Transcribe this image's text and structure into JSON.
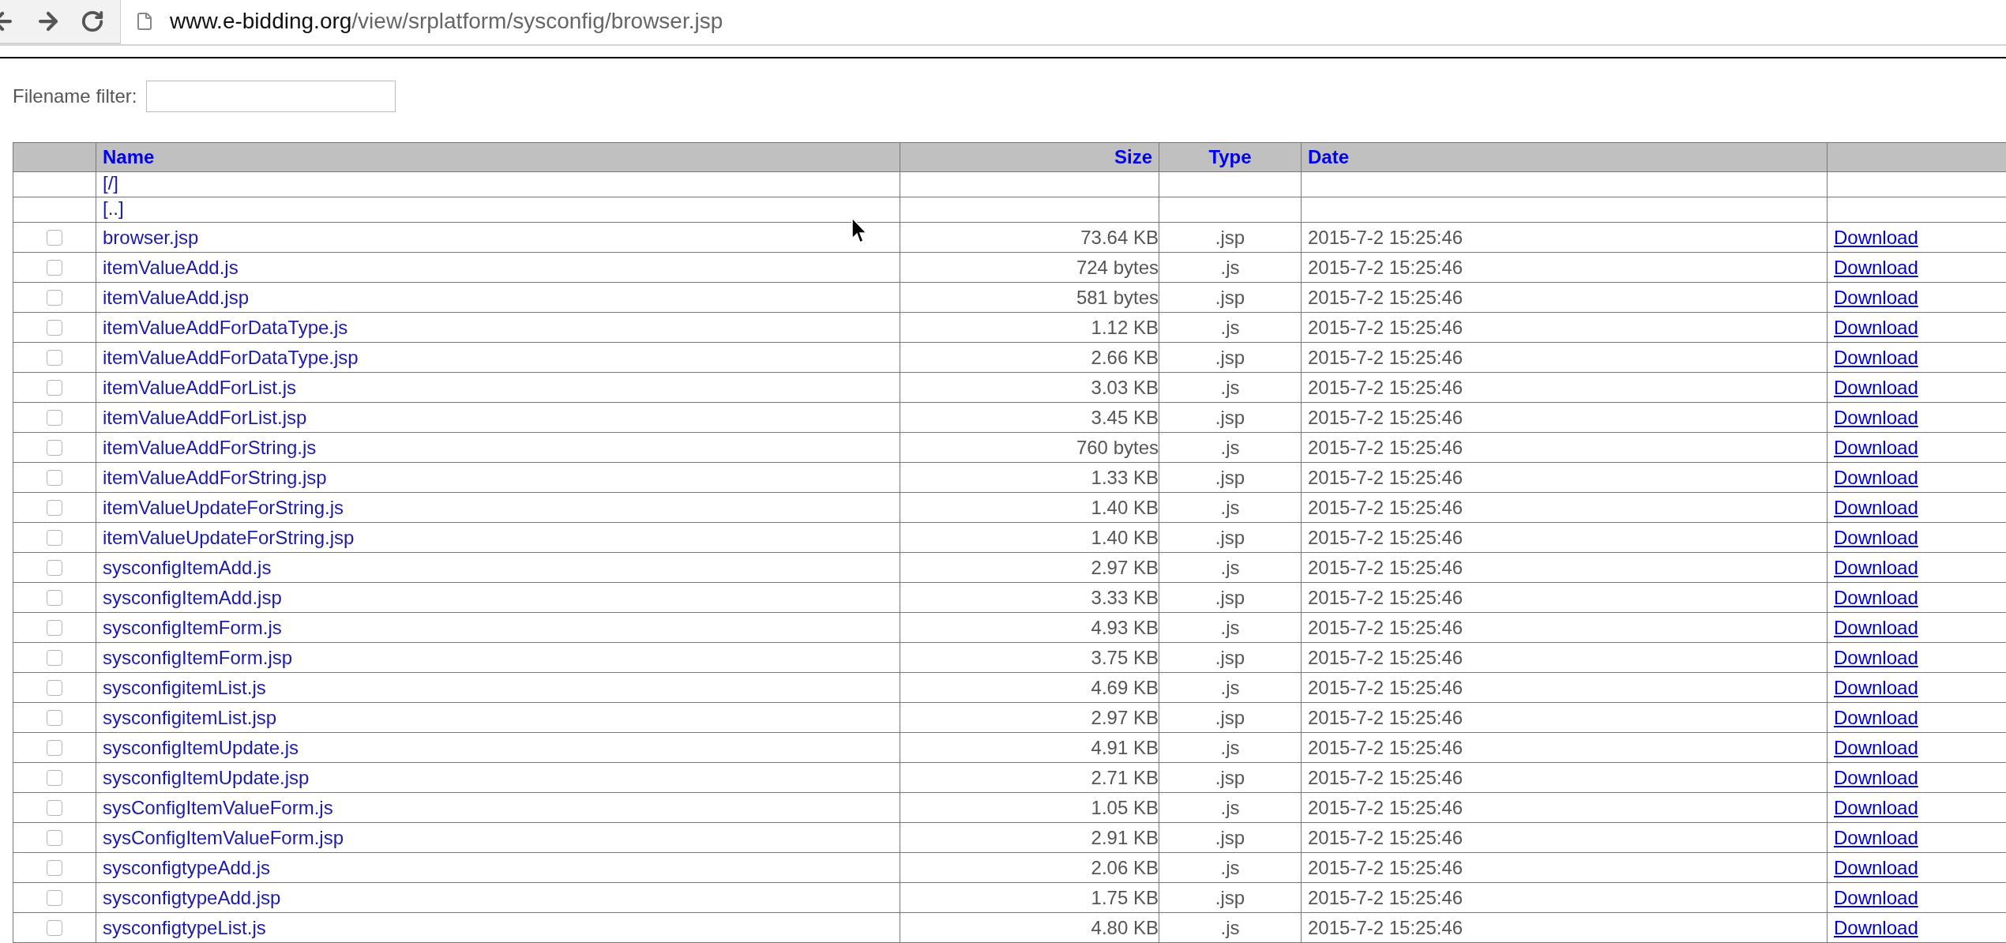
{
  "address_bar": {
    "host": "www.e-bidding.org",
    "path": "/view/srplatform/sysconfig/browser.jsp"
  },
  "filter": {
    "label": "Filename filter:"
  },
  "table": {
    "columns": [
      "Name",
      "Size",
      "Type",
      "Date"
    ],
    "rows": [
      {
        "kind": "dir",
        "name": "[/]"
      },
      {
        "kind": "dir",
        "name": "[..]"
      },
      {
        "kind": "file",
        "checked": false,
        "name": "browser.jsp",
        "size": "73.64 KB",
        "type": ".jsp",
        "date": "2015-7-2 15:25:46",
        "action": "Download"
      },
      {
        "kind": "file",
        "checked": false,
        "name": "itemValueAdd.js",
        "size": "724 bytes",
        "type": ".js",
        "date": "2015-7-2 15:25:46",
        "action": "Download"
      },
      {
        "kind": "file",
        "checked": false,
        "name": "itemValueAdd.jsp",
        "size": "581 bytes",
        "type": ".jsp",
        "date": "2015-7-2 15:25:46",
        "action": "Download"
      },
      {
        "kind": "file",
        "checked": false,
        "name": "itemValueAddForDataType.js",
        "size": "1.12 KB",
        "type": ".js",
        "date": "2015-7-2 15:25:46",
        "action": "Download"
      },
      {
        "kind": "file",
        "checked": false,
        "name": "itemValueAddForDataType.jsp",
        "size": "2.66 KB",
        "type": ".jsp",
        "date": "2015-7-2 15:25:46",
        "action": "Download"
      },
      {
        "kind": "file",
        "checked": false,
        "name": "itemValueAddForList.js",
        "size": "3.03 KB",
        "type": ".js",
        "date": "2015-7-2 15:25:46",
        "action": "Download"
      },
      {
        "kind": "file",
        "checked": false,
        "name": "itemValueAddForList.jsp",
        "size": "3.45 KB",
        "type": ".jsp",
        "date": "2015-7-2 15:25:46",
        "action": "Download"
      },
      {
        "kind": "file",
        "checked": false,
        "name": "itemValueAddForString.js",
        "size": "760 bytes",
        "type": ".js",
        "date": "2015-7-2 15:25:46",
        "action": "Download"
      },
      {
        "kind": "file",
        "checked": false,
        "name": "itemValueAddForString.jsp",
        "size": "1.33 KB",
        "type": ".jsp",
        "date": "2015-7-2 15:25:46",
        "action": "Download"
      },
      {
        "kind": "file",
        "checked": false,
        "name": "itemValueUpdateForString.js",
        "size": "1.40 KB",
        "type": ".js",
        "date": "2015-7-2 15:25:46",
        "action": "Download"
      },
      {
        "kind": "file",
        "checked": false,
        "name": "itemValueUpdateForString.jsp",
        "size": "1.40 KB",
        "type": ".jsp",
        "date": "2015-7-2 15:25:46",
        "action": "Download"
      },
      {
        "kind": "file",
        "checked": false,
        "name": "sysconfigItemAdd.js",
        "size": "2.97 KB",
        "type": ".js",
        "date": "2015-7-2 15:25:46",
        "action": "Download"
      },
      {
        "kind": "file",
        "checked": false,
        "name": "sysconfigItemAdd.jsp",
        "size": "3.33 KB",
        "type": ".jsp",
        "date": "2015-7-2 15:25:46",
        "action": "Download"
      },
      {
        "kind": "file",
        "checked": false,
        "name": "sysconfigItemForm.js",
        "size": "4.93 KB",
        "type": ".js",
        "date": "2015-7-2 15:25:46",
        "action": "Download"
      },
      {
        "kind": "file",
        "checked": false,
        "name": "sysconfigItemForm.jsp",
        "size": "3.75 KB",
        "type": ".jsp",
        "date": "2015-7-2 15:25:46",
        "action": "Download"
      },
      {
        "kind": "file",
        "checked": false,
        "name": "sysconfigitemList.js",
        "size": "4.69 KB",
        "type": ".js",
        "date": "2015-7-2 15:25:46",
        "action": "Download"
      },
      {
        "kind": "file",
        "checked": false,
        "name": "sysconfigitemList.jsp",
        "size": "2.97 KB",
        "type": ".jsp",
        "date": "2015-7-2 15:25:46",
        "action": "Download"
      },
      {
        "kind": "file",
        "checked": false,
        "name": "sysconfigItemUpdate.js",
        "size": "4.91 KB",
        "type": ".js",
        "date": "2015-7-2 15:25:46",
        "action": "Download"
      },
      {
        "kind": "file",
        "checked": false,
        "name": "sysconfigItemUpdate.jsp",
        "size": "2.71 KB",
        "type": ".jsp",
        "date": "2015-7-2 15:25:46",
        "action": "Download"
      },
      {
        "kind": "file",
        "checked": false,
        "name": "sysConfigItemValueForm.js",
        "size": "1.05 KB",
        "type": ".js",
        "date": "2015-7-2 15:25:46",
        "action": "Download"
      },
      {
        "kind": "file",
        "checked": false,
        "name": "sysConfigItemValueForm.jsp",
        "size": "2.91 KB",
        "type": ".jsp",
        "date": "2015-7-2 15:25:46",
        "action": "Download"
      },
      {
        "kind": "file",
        "checked": false,
        "name": "sysconfigtypeAdd.js",
        "size": "2.06 KB",
        "type": ".js",
        "date": "2015-7-2 15:25:46",
        "action": "Download"
      },
      {
        "kind": "file",
        "checked": false,
        "name": "sysconfigtypeAdd.jsp",
        "size": "1.75 KB",
        "type": ".jsp",
        "date": "2015-7-2 15:25:46",
        "action": "Download"
      },
      {
        "kind": "file",
        "checked": false,
        "name": "sysconfigtypeList.js",
        "size": "4.80 KB",
        "type": ".js",
        "date": "2015-7-2 15:25:46",
        "action": "Download"
      }
    ]
  }
}
